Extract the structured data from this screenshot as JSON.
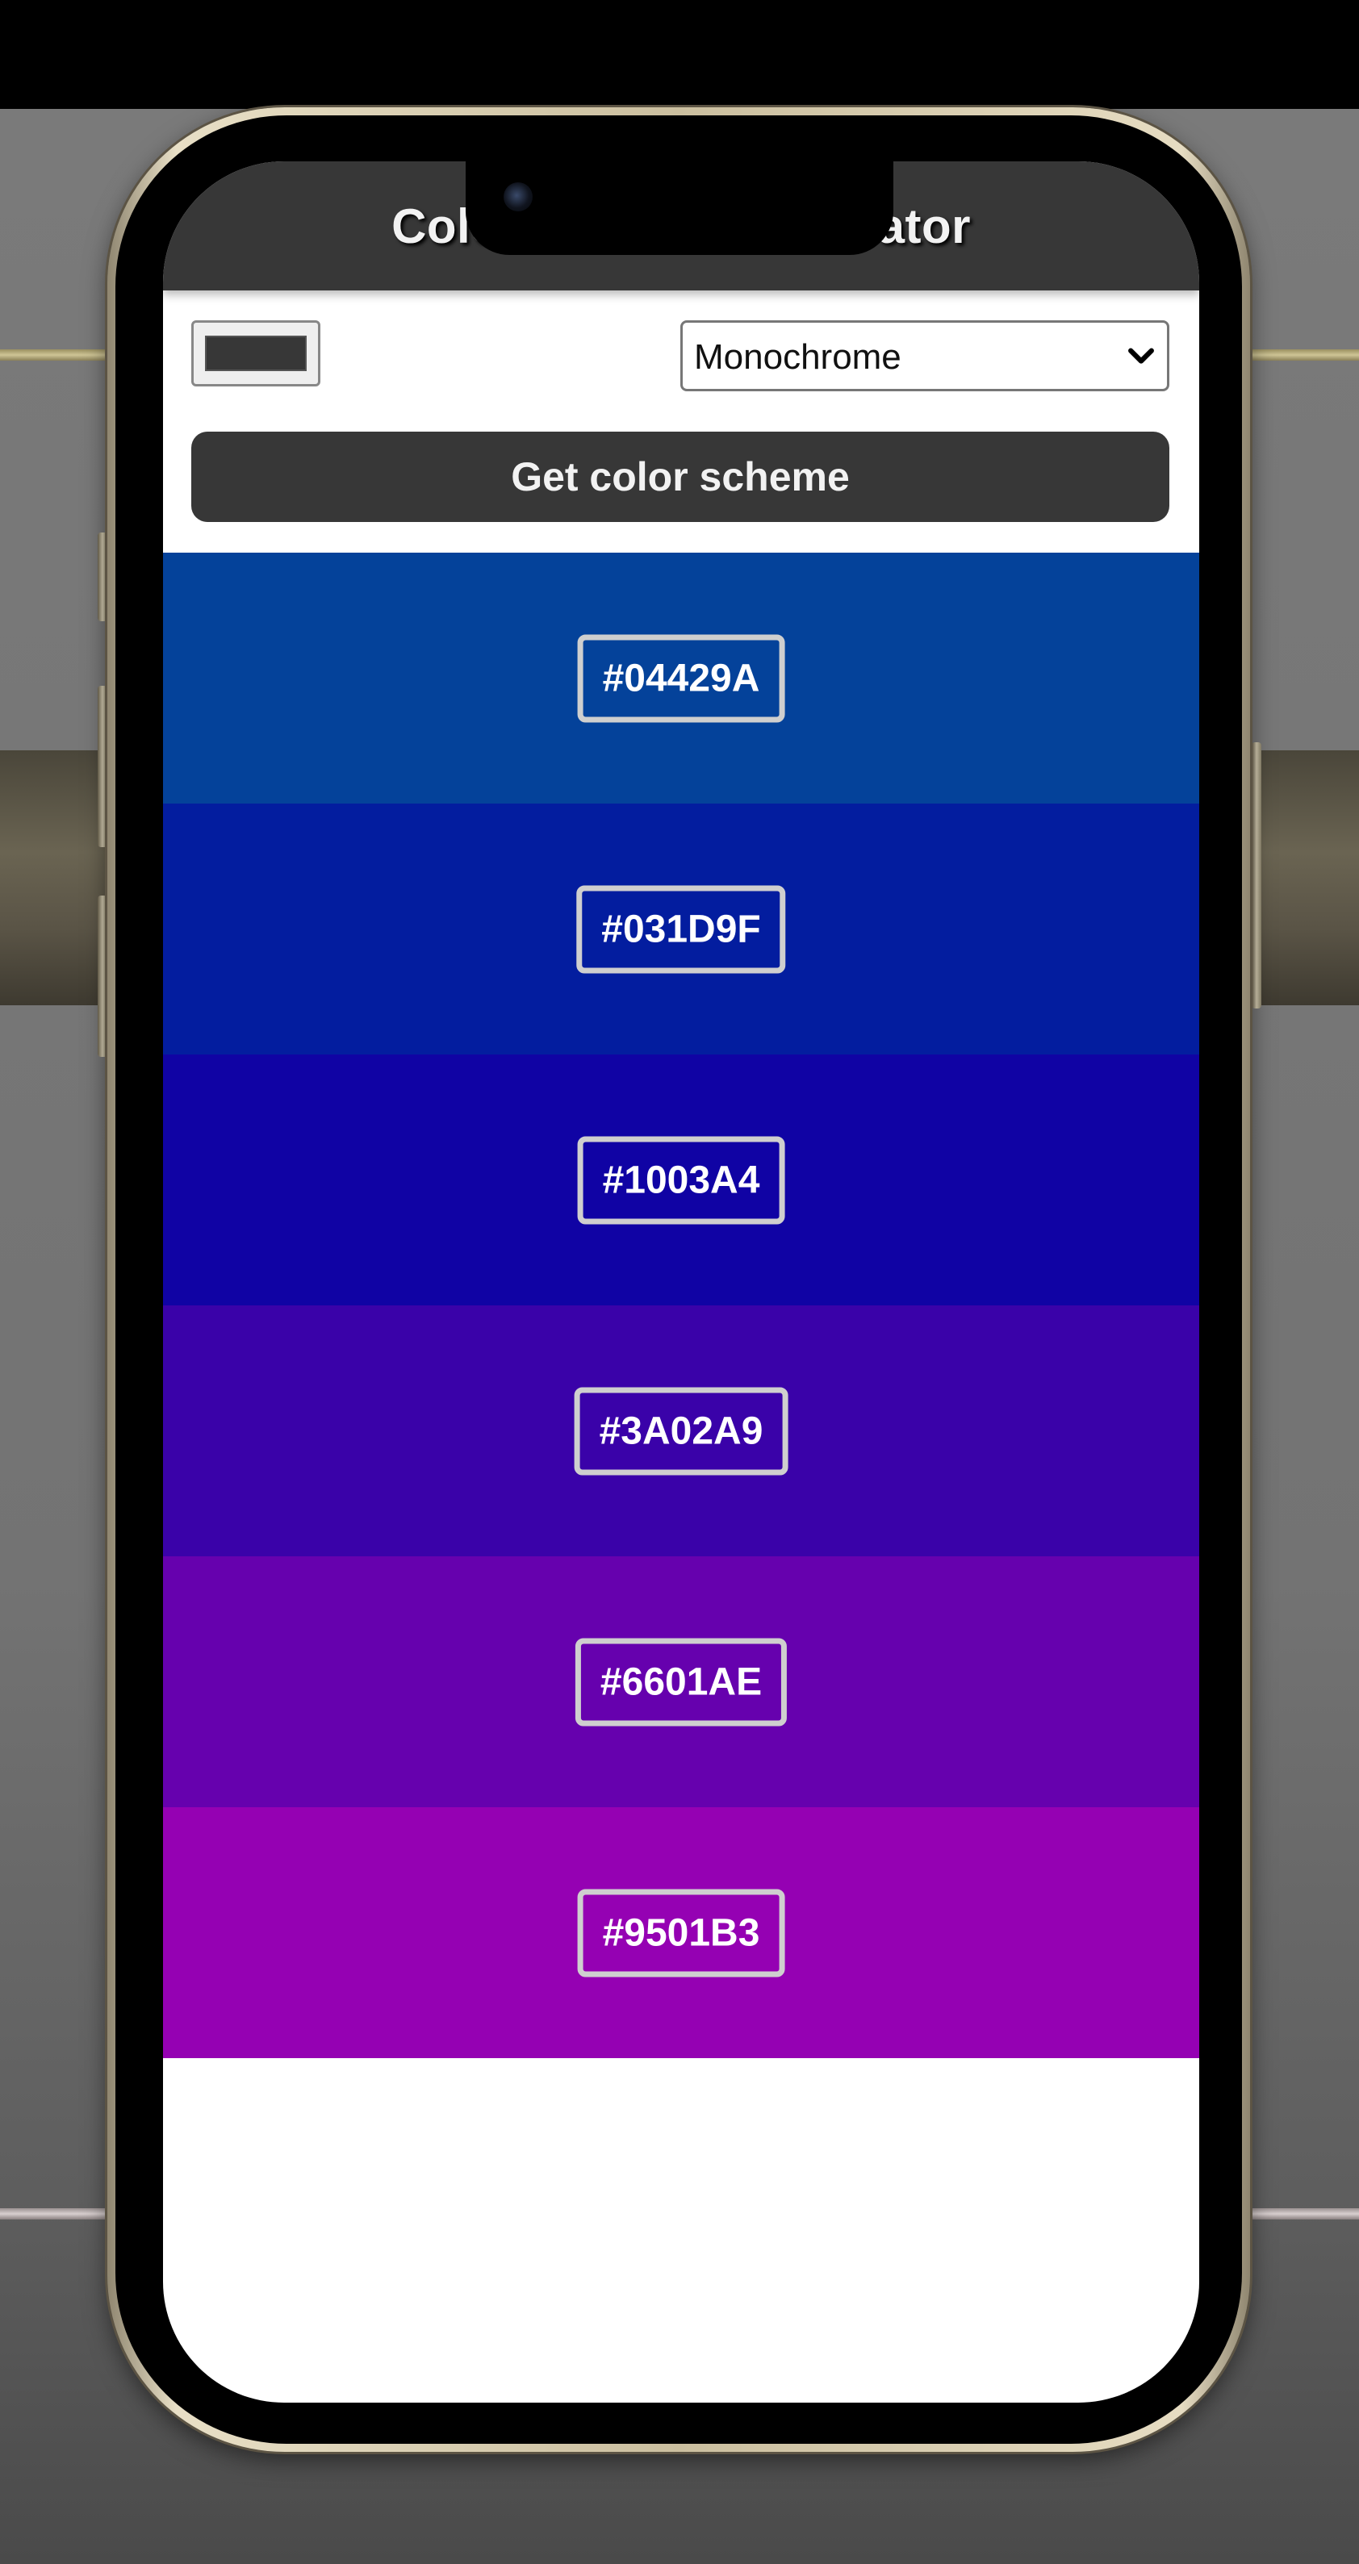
{
  "app": {
    "title": "Color Scheme Generator"
  },
  "controls": {
    "picker_color": "#373737",
    "scheme_selected": "Monochrome",
    "get_button_label": "Get color scheme"
  },
  "colors": [
    {
      "hex": "#04429A"
    },
    {
      "hex": "#031D9F"
    },
    {
      "hex": "#1003A4"
    },
    {
      "hex": "#3A02A9"
    },
    {
      "hex": "#6601AE"
    },
    {
      "hex": "#9501B3"
    }
  ],
  "icons": {
    "select_chevron": "chevron-down-icon"
  }
}
